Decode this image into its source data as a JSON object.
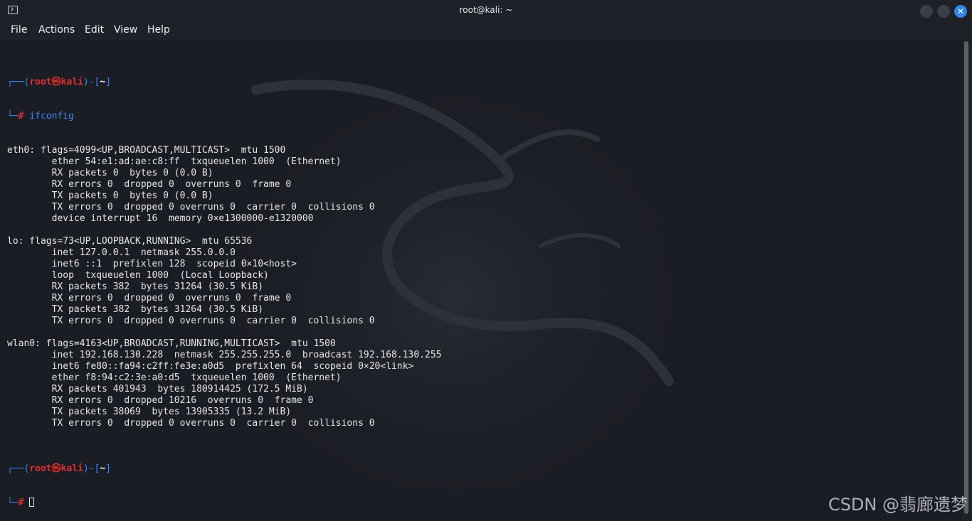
{
  "window": {
    "title": "root@kali: ~",
    "close_glyph": "✕"
  },
  "menu": {
    "items": [
      "File",
      "Actions",
      "Edit",
      "View",
      "Help"
    ]
  },
  "prompt": {
    "corner_top": "┌──(",
    "user": "root㉿kali",
    "mid": ")-[",
    "dir": "~",
    "end": "]",
    "corner_bottom": "└─",
    "hash": "#"
  },
  "command": "ifconfig",
  "output": [
    "eth0: flags=4099<UP,BROADCAST,MULTICAST>  mtu 1500",
    "        ether 54:e1:ad:ae:c8:ff  txqueuelen 1000  (Ethernet)",
    "        RX packets 0  bytes 0 (0.0 B)",
    "        RX errors 0  dropped 0  overruns 0  frame 0",
    "        TX packets 0  bytes 0 (0.0 B)",
    "        TX errors 0  dropped 0 overruns 0  carrier 0  collisions 0",
    "        device interrupt 16  memory 0×e1300000-e1320000",
    "",
    "lo: flags=73<UP,LOOPBACK,RUNNING>  mtu 65536",
    "        inet 127.0.0.1  netmask 255.0.0.0",
    "        inet6 ::1  prefixlen 128  scopeid 0×10<host>",
    "        loop  txqueuelen 1000  (Local Loopback)",
    "        RX packets 382  bytes 31264 (30.5 KiB)",
    "        RX errors 0  dropped 0  overruns 0  frame 0",
    "        TX packets 382  bytes 31264 (30.5 KiB)",
    "        TX errors 0  dropped 0 overruns 0  carrier 0  collisions 0",
    "",
    "wlan0: flags=4163<UP,BROADCAST,RUNNING,MULTICAST>  mtu 1500",
    "        inet 192.168.130.228  netmask 255.255.255.0  broadcast 192.168.130.255",
    "        inet6 fe80::fa94:c2ff:fe3e:a0d5  prefixlen 64  scopeid 0×20<link>",
    "        ether f8:94:c2:3e:a0:d5  txqueuelen 1000  (Ethernet)",
    "        RX packets 401943  bytes 180914425 (172.5 MiB)",
    "        RX errors 0  dropped 10216  overruns 0  frame 0",
    "        TX packets 38069  bytes 13905335 (13.2 MiB)",
    "        TX errors 0  dropped 0 overruns 0  carrier 0  collisions 0",
    ""
  ],
  "watermark": "CSDN @翡廊遗梦",
  "colors": {
    "prompt_blue": "#3b82f6",
    "prompt_red": "#e02d2d",
    "close_button": "#3584e4"
  }
}
